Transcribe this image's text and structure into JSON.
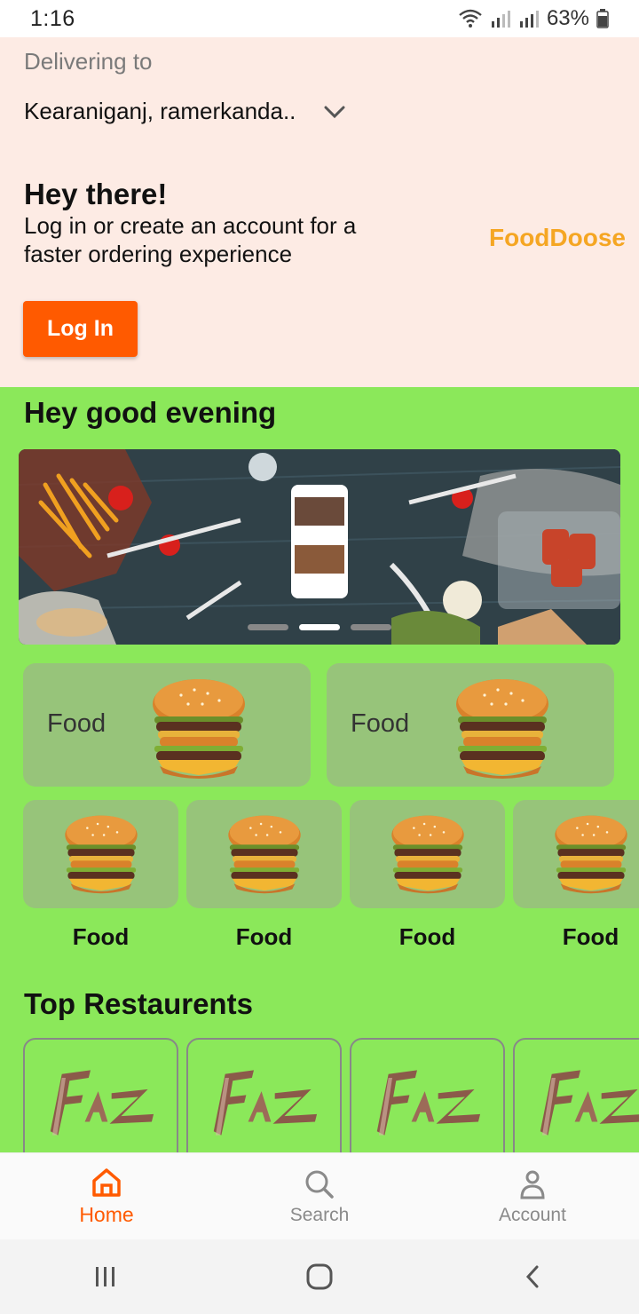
{
  "status_bar": {
    "time": "1:16",
    "battery": "63%"
  },
  "header": {
    "delivering_label": "Delivering to",
    "address": "Kearaniganj, ramerkanda..",
    "title": "Hey there!",
    "subtitle": "Log in or create an account for a faster ordering experience",
    "brand": "FoodDoose",
    "login_label": "Log In"
  },
  "main": {
    "greeting": "Hey good evening",
    "banner": {
      "slides": 3,
      "active_slide": 2
    },
    "big_categories": [
      {
        "label": "Food"
      },
      {
        "label": "Food"
      }
    ],
    "small_categories": [
      {
        "label": "Food"
      },
      {
        "label": "Food"
      },
      {
        "label": "Food"
      },
      {
        "label": "Food"
      }
    ],
    "top_restaurants_title": "Top Restaurents",
    "restaurants": [
      {
        "logo": "faz-logo"
      },
      {
        "logo": "faz-logo"
      },
      {
        "logo": "faz-logo"
      },
      {
        "logo": "faz-logo"
      }
    ]
  },
  "bottom_nav": {
    "items": [
      {
        "label": "Home",
        "icon": "home-icon",
        "active": true
      },
      {
        "label": "Search",
        "icon": "search-icon",
        "active": false
      },
      {
        "label": "Account",
        "icon": "account-icon",
        "active": false
      }
    ]
  },
  "colors": {
    "accent": "#ff5a00",
    "brand": "#f5a623",
    "main_bg": "#8be85a",
    "header_bg": "#fdebe4",
    "card_bg": "#97c47a"
  }
}
